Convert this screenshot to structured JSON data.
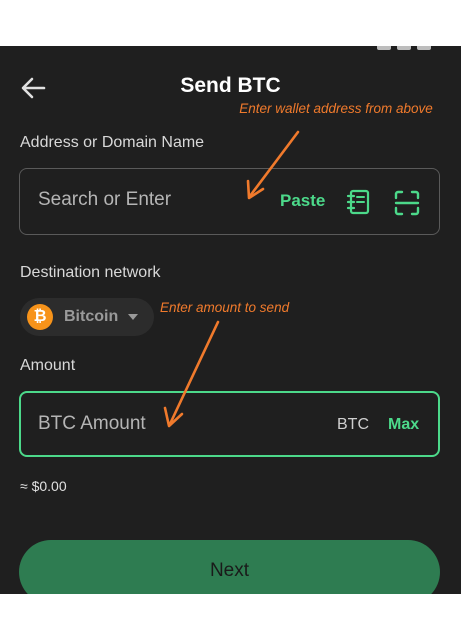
{
  "header": {
    "title": "Send BTC",
    "back_icon": "arrow-left-icon"
  },
  "address": {
    "label": "Address or Domain Name",
    "placeholder": "Search or Enter",
    "paste_label": "Paste",
    "address_book_icon": "address-book-icon",
    "scan_icon": "scan-qr-icon"
  },
  "network": {
    "label": "Destination network",
    "selected": "Bitcoin",
    "logo_glyph": "₿"
  },
  "amount": {
    "label": "Amount",
    "placeholder": "BTC Amount",
    "unit": "BTC",
    "max_label": "Max",
    "fiat_value": "≈ $0.00"
  },
  "next_label": "Next",
  "annotations": {
    "address_hint": "Enter wallet address from above",
    "amount_hint": "Enter amount to send"
  },
  "colors": {
    "background": "#1f1f1f",
    "accent_green": "#4cd98a",
    "next_button": "#2e7c51",
    "annotation_orange": "#f07a2c",
    "bitcoin_orange": "#f7931a"
  }
}
